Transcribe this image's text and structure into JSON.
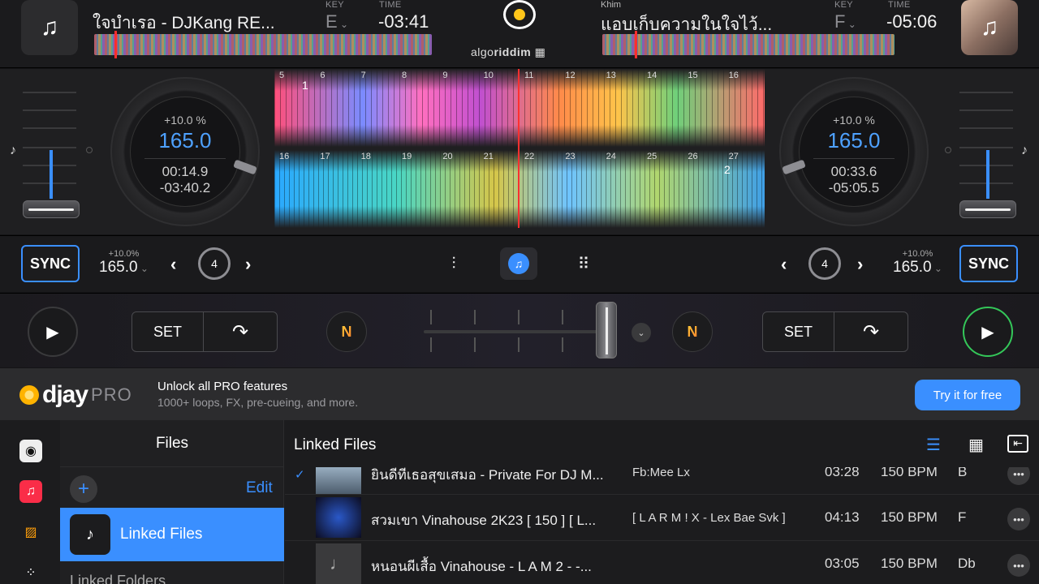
{
  "deck_left": {
    "title": "ใจบำเรอ - DJKang RE...",
    "key_label": "KEY",
    "key_value": "E",
    "time_label": "TIME",
    "time_value": "-03:41",
    "pitch_percent": "+10.0 %",
    "bpm": "165.0",
    "elapsed": "00:14.9",
    "remaining": "-03:40.2",
    "mini_pitch": "+10.0%",
    "mini_bpm": "165.0",
    "loop_size": "4",
    "sync_label": "SYNC",
    "set_label": "SET",
    "marker": "1"
  },
  "deck_right": {
    "artist": "Khim",
    "title": "แอบเก็บความในใจไว้...",
    "key_label": "KEY",
    "key_value": "F",
    "time_label": "TIME",
    "time_value": "-05:06",
    "pitch_percent": "+10.0 %",
    "bpm": "165.0",
    "elapsed": "00:33.6",
    "remaining": "-05:05.5",
    "mini_pitch": "+10.0%",
    "mini_bpm": "165.0",
    "loop_size": "4",
    "sync_label": "SYNC",
    "set_label": "SET",
    "marker": "2"
  },
  "brand": {
    "prefix": "algo",
    "suffix": "riddim"
  },
  "beats_top": [
    "5",
    "6",
    "7",
    "8",
    "9",
    "10",
    "11",
    "12",
    "13",
    "14",
    "15",
    "16"
  ],
  "beats_bottom": [
    "16",
    "17",
    "18",
    "19",
    "20",
    "21",
    "22",
    "23",
    "24",
    "25",
    "26",
    "27"
  ],
  "promo": {
    "logo": "djay",
    "logo_pro": "PRO",
    "title": "Unlock all PRO features",
    "subtitle": "1000+ loops, FX, pre-cueing, and more.",
    "button": "Try it for free"
  },
  "library": {
    "sidebar_title": "Files",
    "edit_label": "Edit",
    "selected_item": "Linked Files",
    "next_item": "Linked Folders",
    "main_title": "Linked Files",
    "rows": [
      {
        "title": "ยินดีที่เธอสุขเสมอ - Private For DJ M...",
        "artist": "Fb:Mee Lx",
        "duration": "03:28",
        "bpm": "150 BPM",
        "key": "B"
      },
      {
        "title": "สวมเขา Vinahouse 2K23 [ 150 ] [ L...",
        "artist": "[ L A R M ! X - Lex Bae Svk ]",
        "duration": "04:13",
        "bpm": "150 BPM",
        "key": "F"
      },
      {
        "title": "หนอนผีเสื้อ Vinahouse - L A M 2 - -...",
        "artist": "",
        "duration": "03:05",
        "bpm": "150 BPM",
        "key": "Db"
      }
    ]
  },
  "colors": {
    "accent": "#3a8fff",
    "play_active": "#34c759",
    "record": "#ffc61a"
  }
}
